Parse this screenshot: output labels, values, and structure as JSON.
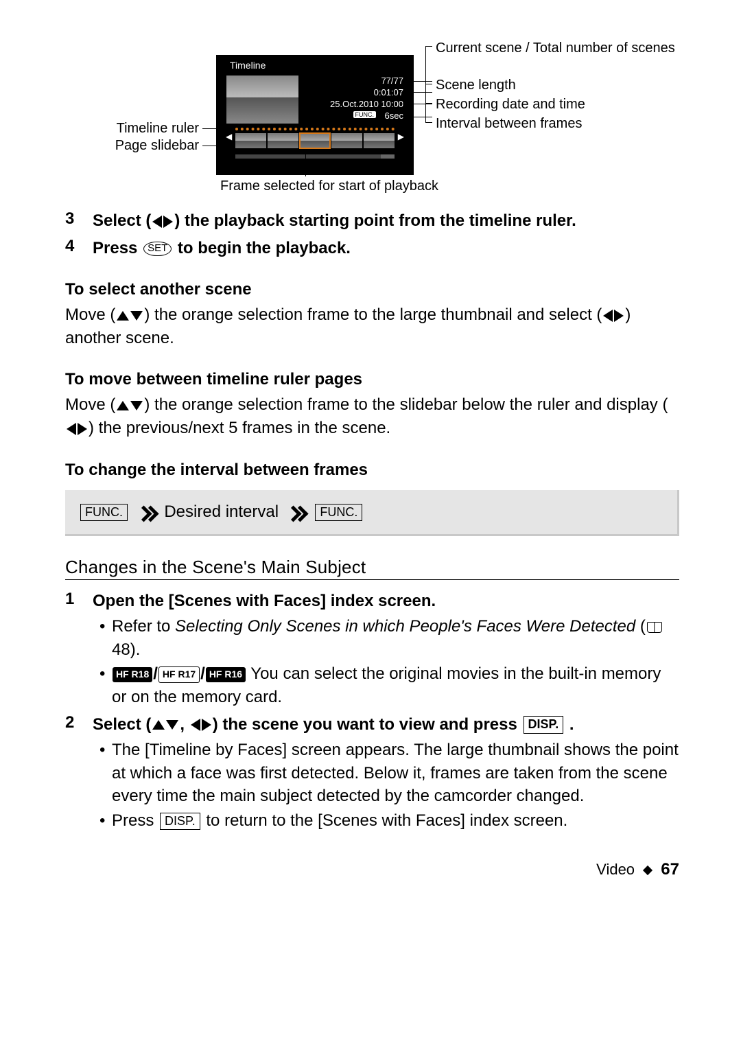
{
  "diagram": {
    "screen": {
      "title": "Timeline",
      "scene_counter": "77/77",
      "length": "0:01:07",
      "date": "25.Oct.2010 10:00",
      "func_label": "FUNC.",
      "interval": "6sec"
    },
    "labels": {
      "scene_count": "Current scene / Total number of scenes",
      "scene_length": "Scene length",
      "date_time": "Recording date and time",
      "interval": "Interval between frames",
      "ruler": "Timeline ruler",
      "slidebar": "Page slidebar",
      "selected_frame": "Frame selected for start of playback"
    }
  },
  "steps_a": {
    "s3_num": "3",
    "s3_a": "Select (",
    "s3_b": ") the playback starting point from the timeline ruler.",
    "s4_num": "4",
    "s4_a": "Press ",
    "s4_set": "SET",
    "s4_b": " to begin the playback."
  },
  "sub1": {
    "head": "To select another scene",
    "a": "Move (",
    "b": ") the orange selection frame to the large thumbnail and select (",
    "c": ") another scene."
  },
  "sub2": {
    "head": "To move between timeline ruler pages",
    "a": "Move (",
    "b": ") the orange selection frame to the slidebar below the ruler and display (",
    "c": ") the previous/next 5 frames in the scene."
  },
  "sub3": {
    "head": "To change the interval between frames",
    "func1": "FUNC.",
    "mid": " Desired interval ",
    "func2": "FUNC."
  },
  "section2": {
    "title": "Changes in the Scene's Main Subject",
    "s1_num": "1",
    "s1_text": "Open the [Scenes with Faces] index screen.",
    "b1_a": "Refer to ",
    "b1_italic": "Selecting Only Scenes in which People's Faces Were Detected",
    "b1_c": " (",
    "b1_page": " 48).",
    "models": {
      "m1": "HF R18",
      "m2": "HF R17",
      "m3": "HF R16"
    },
    "b2_tail": " You can select the original movies in the built-in memory or on the memory card.",
    "s2_num": "2",
    "s2_a": "Select (",
    "s2_b": ", ",
    "s2_c": ") the scene you want to view and press ",
    "s2_disp": "DISP.",
    "s2_d": " .",
    "b3": "The [Timeline by Faces] screen appears. The large thumbnail shows the point at which a face was first detected. Below it, frames are taken from the scene every time the main subject detected by the camcorder changed.",
    "b4_a": "Press ",
    "b4_disp": "DISP.",
    "b4_b": " to return to the [Scenes with Faces] index screen."
  },
  "footer": {
    "section": "Video",
    "page": "67"
  }
}
